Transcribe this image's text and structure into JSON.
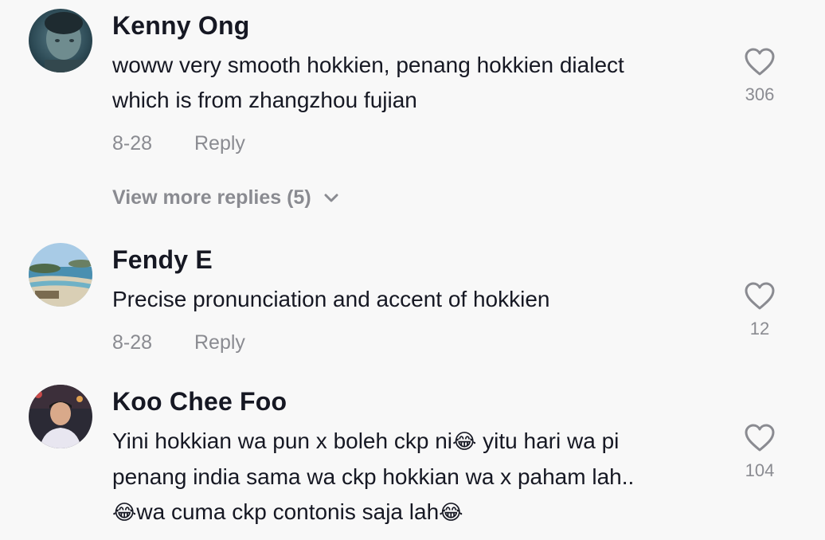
{
  "comments": [
    {
      "username": "Kenny Ong",
      "text_lines": [
        "woww very smooth hokkien, penang hokkien dialect",
        "which is from zhangzhou fujian"
      ],
      "date": "8-28",
      "reply_label": "Reply",
      "like_count": "306",
      "avatar_icon": "avatar-photo"
    },
    {
      "username": "Fendy E",
      "text_lines": [
        "Precise pronunciation and accent of hokkien"
      ],
      "date": "8-28",
      "reply_label": "Reply",
      "like_count": "12",
      "avatar_icon": "avatar-beach-photo"
    },
    {
      "username": "Koo Chee Foo",
      "text_parts": {
        "line1_a": "Yini hokkian wa pun x boleh ckp ni",
        "line1_b": " yitu hari wa pi",
        "line2": "penang india sama wa ckp hokkian wa x paham lah..",
        "line3_a": "wa cuma ckp contonis saja lah",
        "emoji": "😂"
      },
      "like_count": "104",
      "avatar_icon": "avatar-person-photo"
    }
  ],
  "view_more_replies": "View more replies (5)",
  "colors": {
    "background": "#f8f8f8",
    "primary_text": "#161823",
    "secondary_text": "#8a8b91"
  }
}
